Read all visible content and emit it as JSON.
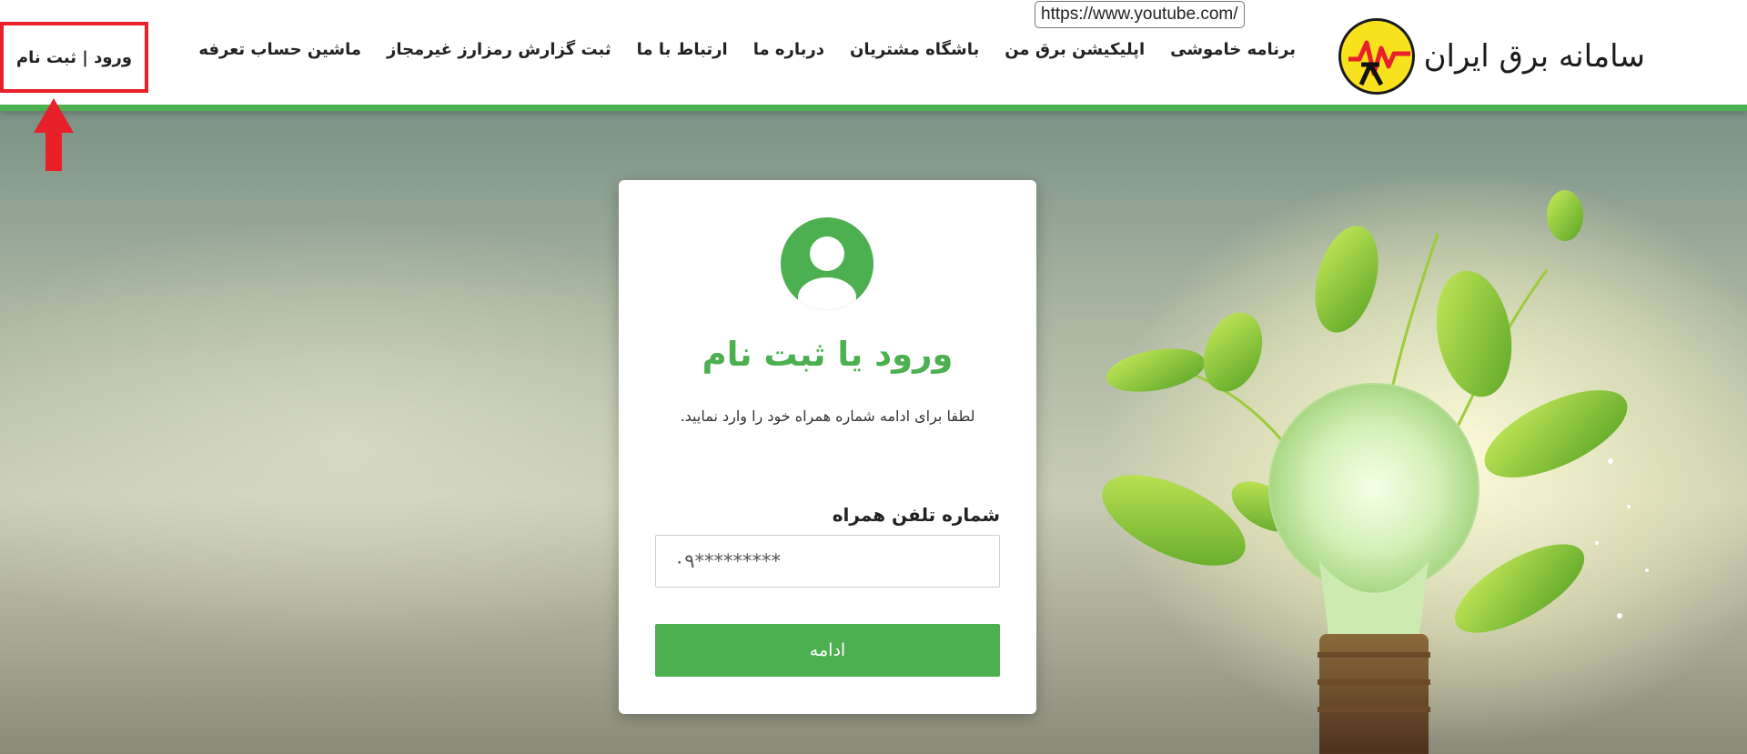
{
  "tooltip": {
    "url": "https://www.youtube.com/"
  },
  "brand": {
    "name": "سامانه برق ایران",
    "logo_icon": "electric-power-logo-icon"
  },
  "nav": {
    "items": [
      {
        "label": "برنامه خاموشی"
      },
      {
        "label": "اپلیکیشن برق من"
      },
      {
        "label": "باشگاه مشتریان"
      },
      {
        "label": "درباره ما"
      },
      {
        "label": "ارتباط با ما"
      },
      {
        "label": "ثبت گزارش رمزارز غیرمجاز"
      },
      {
        "label": "ماشین حساب تعرفه"
      }
    ]
  },
  "auth_link": {
    "label": "ورود | ثبت نام"
  },
  "login_card": {
    "title": "ورود یا ثبت نام",
    "subtitle": "لطفا برای ادامه شماره همراه خود را وارد نمایید.",
    "phone_label": "شماره تلفن همراه",
    "phone_placeholder": "۰۹*********",
    "submit_label": "ادامه"
  },
  "colors": {
    "accent": "#4caf50",
    "highlight_red": "#e8202a",
    "logo_yellow": "#f7e21d"
  }
}
